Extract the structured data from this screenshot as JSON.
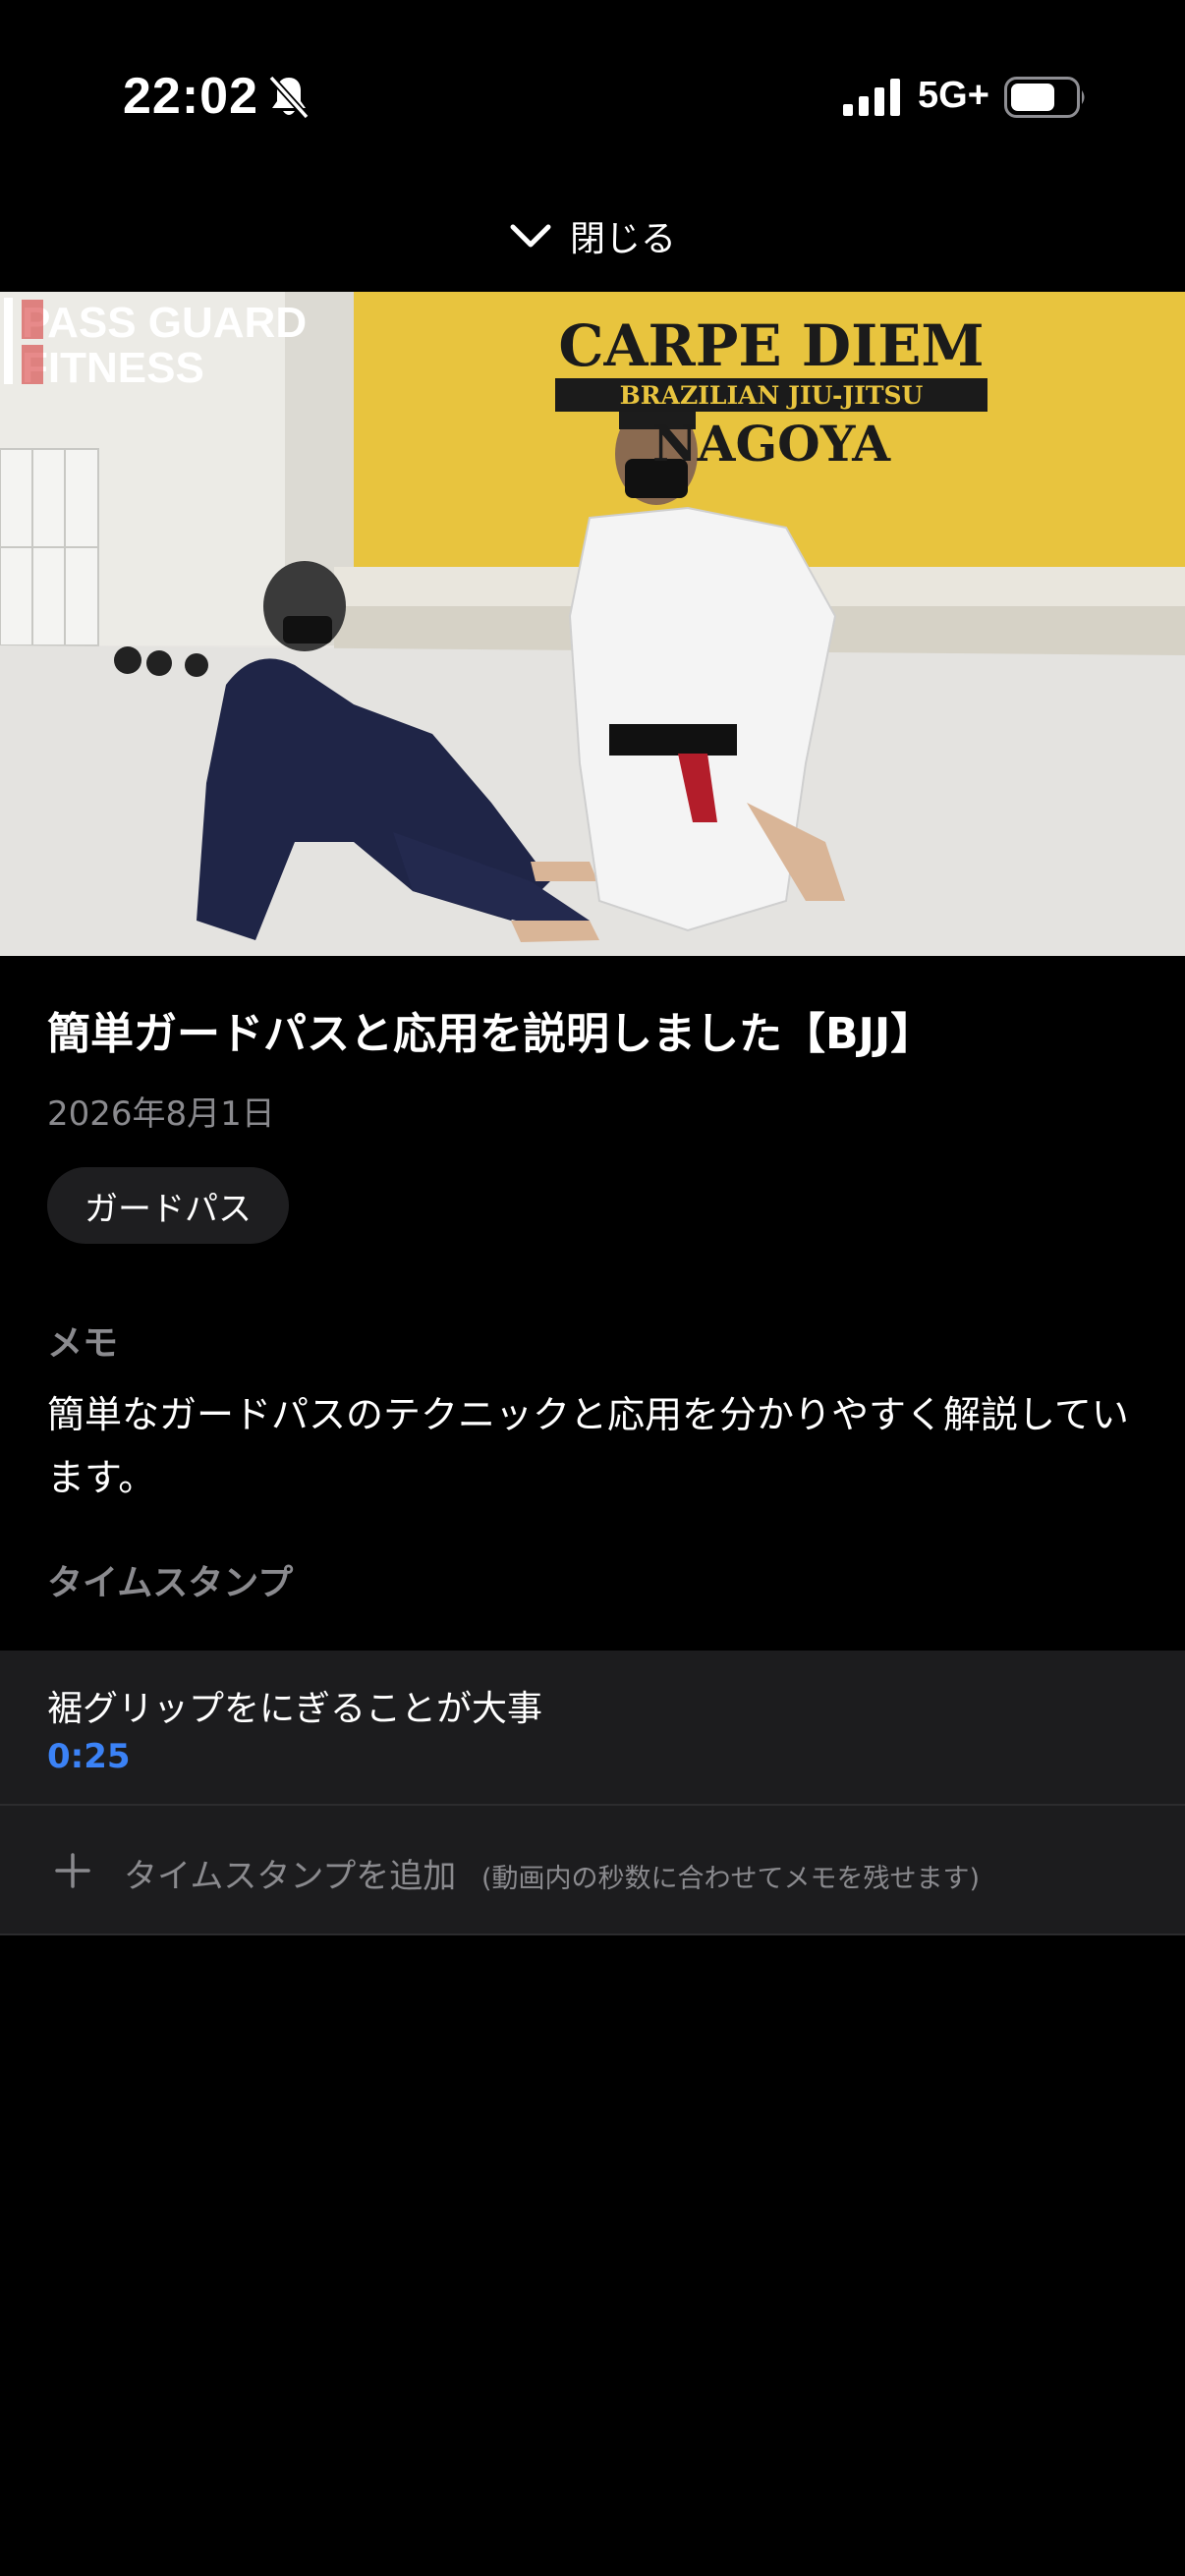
{
  "status_bar": {
    "time": "22:02",
    "network": "5G+",
    "icons": [
      "bell-slash-icon",
      "cellular-signal-icon",
      "battery-icon"
    ]
  },
  "close_bar": {
    "label": "閉じる",
    "icon": "chevron-down-icon"
  },
  "video": {
    "watermark_line1": "PASS GUARD",
    "watermark_line2": "FITNESS",
    "sign_line1": "CARPE DIEM",
    "sign_line2": "BRAZILIAN JIU-JITSU",
    "sign_line3": "NAGOYA"
  },
  "video_detail": {
    "title": "簡単ガードパスと応用を説明しました【BJJ】",
    "date": "2026年8月1日",
    "tag": "ガードパス"
  },
  "memo": {
    "heading": "メモ",
    "text": "簡単なガードパスのテクニックと応用を分かりやすく解説しています。"
  },
  "timestamps": {
    "heading": "タイムスタンプ",
    "items": [
      {
        "label": "裾グリップをにぎることが大事",
        "time": "0:25"
      }
    ],
    "add_label": "タイムスタンプを追加",
    "add_hint": "(動画内の秒数に合わせてメモを残せます)"
  },
  "colors": {
    "background": "#000000",
    "accent_blue": "#3b82f6",
    "secondary_text": "#8a8a8e",
    "row_background": "#1c1c1e"
  }
}
